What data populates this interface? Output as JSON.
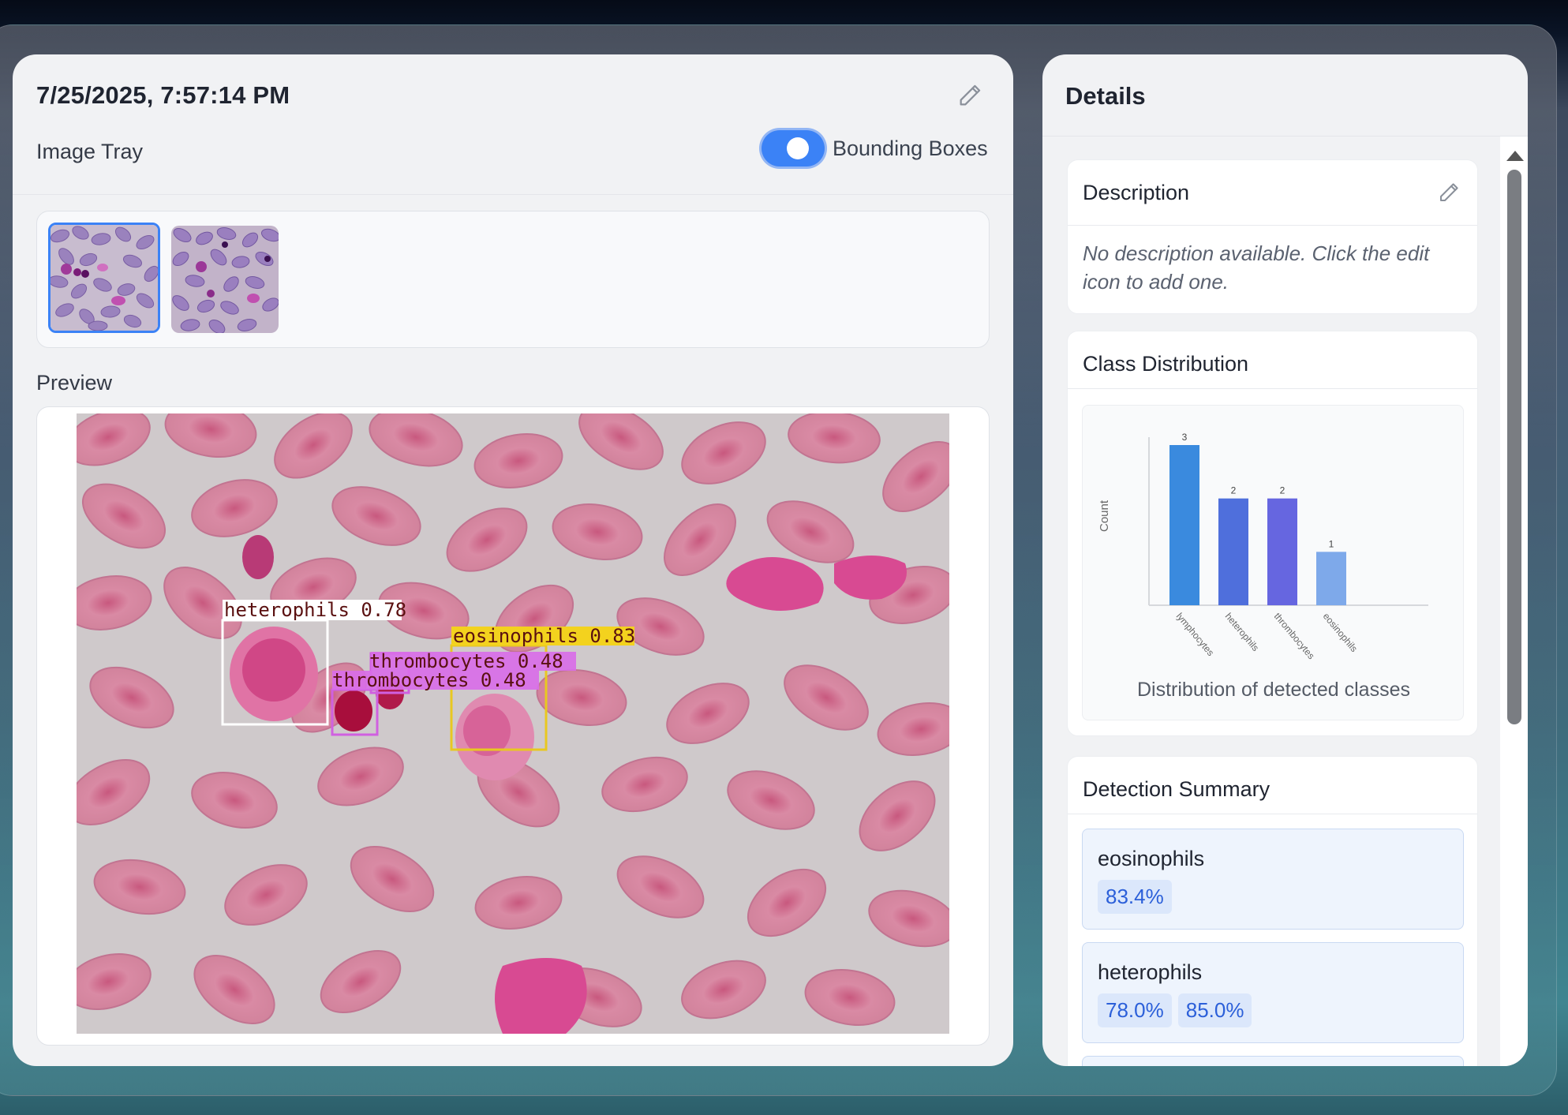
{
  "header": {
    "timestamp": "7/25/2025, 7:57:14 PM",
    "image_tray_label": "Image Tray",
    "bounding_boxes_label": "Bounding Boxes",
    "bounding_boxes_enabled": true
  },
  "thumbnails": [
    {
      "selected": true
    },
    {
      "selected": false
    }
  ],
  "preview": {
    "label": "Preview",
    "detections": [
      {
        "label": "heterophils 0.78",
        "color": "#ffffff",
        "text_color": "#5a1010",
        "label_bg": "#ffffff"
      },
      {
        "label": "eosinophils 0.83",
        "color": "#e8c820",
        "text_color": "#5a1010",
        "label_bg": "#f3d21e"
      },
      {
        "label": "thrombocytes 0.48",
        "color": "#d060e0",
        "text_color": "#5a1010",
        "label_bg": "#d96ee8"
      },
      {
        "label": "thrombocytes 0.48",
        "color": "#d060e0",
        "text_color": "#5a1010",
        "label_bg": "#d96ee8"
      }
    ]
  },
  "details": {
    "title": "Details",
    "description": {
      "title": "Description",
      "text": "No description available. Click the edit icon to add one."
    },
    "class_distribution": {
      "title": "Class Distribution",
      "chart_caption": "Distribution of detected classes"
    },
    "detection_summary": {
      "title": "Detection Summary",
      "items": [
        {
          "name": "eosinophils",
          "confidences": [
            "83.4%"
          ]
        },
        {
          "name": "heterophils",
          "confidences": [
            "78.0%",
            "85.0%"
          ]
        }
      ]
    }
  },
  "chart_data": {
    "type": "bar",
    "title": "Distribution of detected classes",
    "ylabel": "Count",
    "xlabel": "",
    "categories": [
      "lymphocytes",
      "heterophils",
      "thrombocytes",
      "eosinophils"
    ],
    "values": [
      3,
      2,
      2,
      1
    ],
    "data_labels": [
      "3",
      "2",
      "2",
      "1"
    ],
    "colors": [
      "#3a8ade",
      "#4f6fdc",
      "#6666e0",
      "#7ea9ea"
    ],
    "ylim": [
      0,
      3
    ],
    "grid": false,
    "legend": "none"
  }
}
